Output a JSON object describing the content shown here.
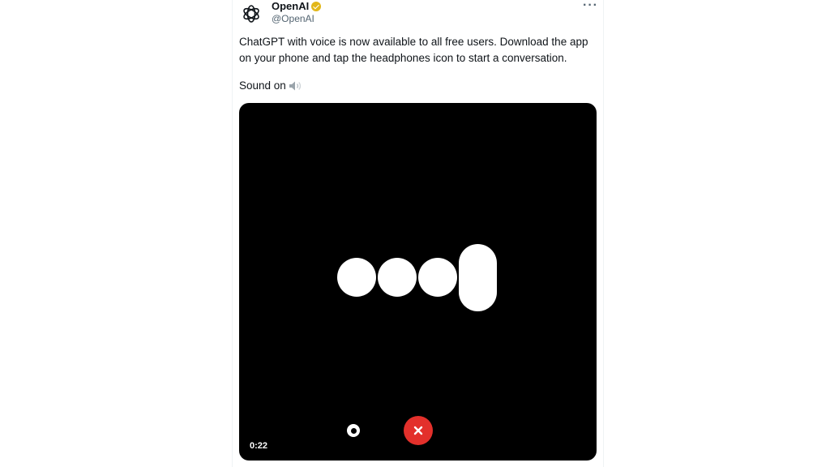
{
  "tweet": {
    "author_name": "OpenAI",
    "author_handle": "@OpenAI",
    "more_label": "···",
    "text": "ChatGPT with voice is now available to all free users. Download the app on your phone and tap the headphones icon to start a conversation.",
    "sound_label": "Sound on"
  },
  "video": {
    "timestamp": "0:22",
    "record_icon": "record-icon",
    "end_call_icon": "close-icon"
  },
  "colors": {
    "verified_badge": "#e2b719",
    "end_call": "#e3302b",
    "video_bg": "#000000"
  }
}
